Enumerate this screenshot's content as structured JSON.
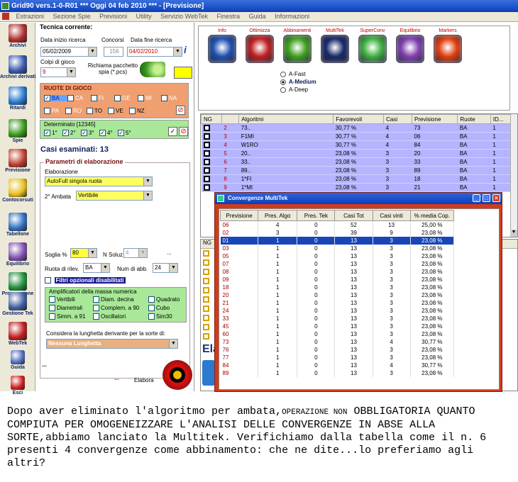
{
  "window": {
    "title": "Grid90 vers.1-0-R01  ***  Oggi 04 feb 2010  ***  - [Previsione]"
  },
  "menu": [
    "Estrazioni",
    "Sezione Spie",
    "Previsioni",
    "Utility",
    "Servizio WebTek",
    "Finestra",
    "Guida",
    "Informazioni"
  ],
  "sidebar": [
    {
      "label": "Archivi",
      "icon": "book-icon",
      "color": "#b03030"
    },
    {
      "label": "Archivi derivati",
      "icon": "archive-icon",
      "color": "#3a5ab0"
    },
    {
      "label": "Ritardi",
      "icon": "clock-icon",
      "color": "#2a7ad0"
    },
    {
      "label": "Spie",
      "icon": "spyglass-icon",
      "color": "#3a9a20"
    },
    {
      "label": "Previsione",
      "icon": "checklist-icon",
      "color": "#c04030"
    },
    {
      "label": "Contocorsuti",
      "icon": "bulb-icon",
      "color": "#e8c020"
    },
    {
      "label": "Tabellone",
      "icon": "calendar-icon",
      "color": "#3070c0"
    },
    {
      "label": "Equilibrio",
      "icon": "balance-icon",
      "color": "#8050b0"
    },
    {
      "label": "Progressione",
      "icon": "dollar-icon",
      "color": "#209040"
    },
    {
      "label": "Gestione Tek",
      "icon": "tools-icon",
      "color": "#4060a0"
    },
    {
      "label": "WebTek",
      "icon": "a-letter-icon",
      "color": "#c02020"
    },
    {
      "label": "Guida",
      "icon": "pen-icon",
      "color": "#5070c0"
    },
    {
      "label": "Esci",
      "icon": "power-icon",
      "color": "#d02020"
    }
  ],
  "left": {
    "tecnica_title": "Tecnica corrente:",
    "data_inizio_label": "Data inizio ricerca",
    "data_inizio": "05/02/2009",
    "concorsi_label": "Concorsi",
    "concorsi": "156",
    "data_fine_label": "Data fine ricerca",
    "data_fine": "04/02/2010",
    "colpi_label": "Colpi di gioco",
    "colpi": "9",
    "richiama_label": "Richiama pacchetto spia (*.pcs)",
    "ruote_title": "RUOTE DI GIOCO",
    "ruote_row1": [
      "BA",
      "CA",
      "FI",
      "GE",
      "MI",
      "NA"
    ],
    "ruote_row2": [
      "PA",
      "RO",
      "TO",
      "VE",
      "NZ"
    ],
    "determinato_label": "Determinato [12345]",
    "determinato": [
      "1°",
      "2°",
      "3°",
      "4°",
      "5°"
    ],
    "casi_label": "Casi esaminati: 13",
    "param_title": "Parametri di elaborazione",
    "elaborazione_label": "Elaborazione",
    "elaborazione": "AutoFull singola ruota",
    "ambata_label": "2° Ambata",
    "ambata": "Vertibile",
    "soglia_label": "Soglia %",
    "soglia": "80",
    "nsoluz_label": "N Soluz.",
    "nsoluz": "4",
    "nsoluz_more": "...",
    "ruota_label": "Ruota di rilev.",
    "ruota": "BA",
    "numabb_label": "Num di abb.",
    "numabb": "24",
    "filtri_label": "Filtri opzionali disabilitati",
    "ampl_title": "Amplificatori della massa numerica",
    "ampl": [
      "Vertibili",
      "Diam. decina",
      "Quadrato",
      "Diametrali",
      "Complem. a 90",
      "Cubo",
      "Simm. a 91",
      "Oscillatori",
      "Sim30"
    ],
    "lunghezza_label": "Considera la lunghetta derivante per la sorte di:",
    "lunghezza": "Nessuna Lunghetta",
    "dots": "...",
    "elabora_dots": "...",
    "elabora_label": "Elabora"
  },
  "toolbar": [
    {
      "label": "Info",
      "icon": "question-icon",
      "color": "#2050b0"
    },
    {
      "label": "Ottimizza",
      "icon": "flame-icon",
      "color": "#c02020"
    },
    {
      "label": "Abbinamenti",
      "icon": "gear-icon",
      "color": "#40a020"
    },
    {
      "label": "MultiTek",
      "icon": "swirl-icon",
      "color": "#1a2a6a"
    },
    {
      "label": "SuperConv",
      "icon": "recycle-icon",
      "color": "#40b040"
    },
    {
      "label": "Equilibrio",
      "icon": "balance-icon",
      "color": "#8040b0"
    },
    {
      "label": "Markers",
      "icon": "burst-icon",
      "color": "#e04010"
    }
  ],
  "radio": [
    "A-Fast",
    "A-Medium",
    "A-Deep"
  ],
  "radio_selected": 1,
  "grid": {
    "headers": [
      "NG",
      "",
      "Algoritmi",
      "Favorevoli",
      "Casi",
      "Previsione",
      "Ruote",
      "ID..."
    ],
    "rows": [
      [
        "2",
        "73..",
        "30,77 %",
        "4",
        "73",
        "BA",
        "1"
      ],
      [
        "3",
        "F1MI",
        "30,77 %",
        "4",
        "06",
        "BA",
        "1"
      ],
      [
        "4",
        "W1RO",
        "30,77 %",
        "4",
        "84",
        "BA",
        "1"
      ],
      [
        "5",
        "20..",
        "23,08 %",
        "3",
        "20",
        "BA",
        "1"
      ],
      [
        "6",
        "33..",
        "23,08 %",
        "3",
        "33",
        "BA",
        "1"
      ],
      [
        "7",
        "89..",
        "23,08 %",
        "3",
        "89",
        "BA",
        "1"
      ],
      [
        "8",
        "1*FI",
        "23,08 %",
        "3",
        "18",
        "BA",
        "1"
      ],
      [
        "9",
        "1*MI",
        "23,08 %",
        "3",
        "21",
        "BA",
        "1"
      ]
    ]
  },
  "grid2": {
    "header": "NG",
    "partial_label": "Ela"
  },
  "popup": {
    "title": "Convergenze MultiTek",
    "headers": [
      "Previsione",
      "Pres. Algo",
      "Pres. Tek",
      "Casi Tot",
      "Casi vinti",
      "% media Cop."
    ],
    "rows": [
      [
        "06",
        "4",
        "0",
        "52",
        "13",
        "25,00 %"
      ],
      [
        "02",
        "3",
        "0",
        "39",
        "9",
        "23,08 %"
      ],
      [
        "01",
        "1",
        "0",
        "13",
        "3",
        "23,08 %"
      ],
      [
        "03",
        "1",
        "0",
        "13",
        "3",
        "23,08 %"
      ],
      [
        "05",
        "1",
        "0",
        "13",
        "3",
        "23,08 %"
      ],
      [
        "07",
        "1",
        "0",
        "13",
        "3",
        "23,08 %"
      ],
      [
        "08",
        "1",
        "0",
        "13",
        "3",
        "23,08 %"
      ],
      [
        "09",
        "1",
        "0",
        "13",
        "3",
        "23,08 %"
      ],
      [
        "18",
        "1",
        "0",
        "13",
        "3",
        "23,08 %"
      ],
      [
        "20",
        "1",
        "0",
        "13",
        "3",
        "23,08 %"
      ],
      [
        "21",
        "1",
        "0",
        "13",
        "3",
        "23,08 %"
      ],
      [
        "24",
        "1",
        "0",
        "13",
        "3",
        "23,08 %"
      ],
      [
        "33",
        "1",
        "0",
        "13",
        "3",
        "23,08 %"
      ],
      [
        "45",
        "1",
        "0",
        "13",
        "3",
        "23,08 %"
      ],
      [
        "60",
        "1",
        "0",
        "13",
        "3",
        "23,08 %"
      ],
      [
        "73",
        "1",
        "0",
        "13",
        "4",
        "30,77 %"
      ],
      [
        "76",
        "1",
        "0",
        "13",
        "3",
        "23,08 %"
      ],
      [
        "77",
        "1",
        "0",
        "13",
        "3",
        "23,08 %"
      ],
      [
        "84",
        "1",
        "0",
        "13",
        "4",
        "30,77 %"
      ],
      [
        "89",
        "1",
        "0",
        "13",
        "3",
        "23,08 %"
      ]
    ],
    "selected_row": 2
  },
  "caption": {
    "p1": "Dopo aver eliminato l'algoritmo per ambata,",
    "p2": "OPERAZIONE NON",
    "p3": "OBBLIGATORIA QUANTO COMPIUTA PER OMOGENEIZZARE L'ANALISI DELLE CONVERGENZE IN ABSE ALLA SORTE,",
    "p4": "abbiamo lanciato la Multitek. Verifichiamo dalla tabella come il n. 6 presenti 4 convergenze come abbinamento: che ne dite...lo preferiamo agli altri?"
  },
  "colors": {
    "grid_row": "#b4b4ff",
    "popup_frame": "#d23a1a",
    "selection": "#1846b8",
    "ruote_bg": "#f0a070"
  }
}
